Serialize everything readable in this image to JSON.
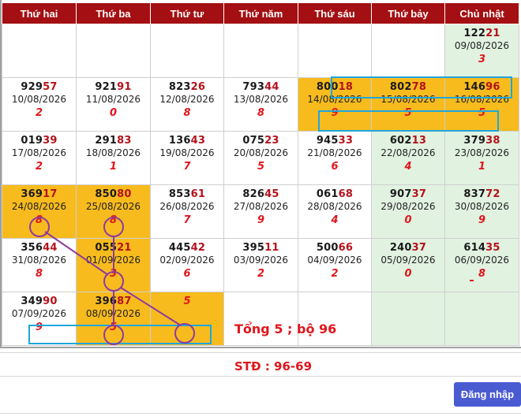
{
  "calendar": {
    "headers": [
      "Thứ hai",
      "Thứ ba",
      "Thứ tư",
      "Thứ năm",
      "Thứ sáu",
      "Thứ bảy",
      "Chủ nhật"
    ],
    "weeks": [
      [
        null,
        null,
        null,
        null,
        null,
        null,
        {
          "head": "122",
          "tail": "21",
          "date": "09/08/2026",
          "sum": "3",
          "style": "weekend"
        }
      ],
      [
        {
          "head": "929",
          "tail": "57",
          "date": "10/08/2026",
          "sum": "2",
          "style": "white"
        },
        {
          "head": "921",
          "tail": "91",
          "date": "11/08/2026",
          "sum": "0",
          "style": "white"
        },
        {
          "head": "823",
          "tail": "26",
          "date": "12/08/2026",
          "sum": "8",
          "style": "white"
        },
        {
          "head": "793",
          "tail": "44",
          "date": "13/08/2026",
          "sum": "8",
          "style": "white"
        },
        {
          "head": "800",
          "tail": "18",
          "date": "14/08/2026",
          "sum": "9",
          "style": "hl"
        },
        {
          "head": "802",
          "tail": "78",
          "date": "15/08/2026",
          "sum": "5",
          "style": "hl"
        },
        {
          "head": "146",
          "tail": "96",
          "date": "16/08/2026",
          "sum": "5",
          "style": "hl"
        }
      ],
      [
        {
          "head": "019",
          "tail": "39",
          "date": "17/08/2026",
          "sum": "2",
          "style": "white"
        },
        {
          "head": "291",
          "tail": "83",
          "date": "18/08/2026",
          "sum": "1",
          "style": "white"
        },
        {
          "head": "136",
          "tail": "43",
          "date": "19/08/2026",
          "sum": "7",
          "style": "white"
        },
        {
          "head": "075",
          "tail": "23",
          "date": "20/08/2026",
          "sum": "5",
          "style": "white"
        },
        {
          "head": "945",
          "tail": "33",
          "date": "21/08/2026",
          "sum": "6",
          "style": "white"
        },
        {
          "head": "602",
          "tail": "13",
          "date": "22/08/2026",
          "sum": "4",
          "style": "weekend"
        },
        {
          "head": "379",
          "tail": "38",
          "date": "23/08/2026",
          "sum": "1",
          "style": "weekend"
        }
      ],
      [
        {
          "head": "369",
          "tail": "17",
          "date": "24/08/2026",
          "sum": "8",
          "style": "hl"
        },
        {
          "head": "850",
          "tail": "80",
          "date": "25/08/2026",
          "sum": "8",
          "style": "hl"
        },
        {
          "head": "853",
          "tail": "61",
          "date": "26/08/2026",
          "sum": "7",
          "style": "white"
        },
        {
          "head": "826",
          "tail": "45",
          "date": "27/08/2026",
          "sum": "9",
          "style": "white"
        },
        {
          "head": "061",
          "tail": "68",
          "date": "28/08/2026",
          "sum": "4",
          "style": "white"
        },
        {
          "head": "907",
          "tail": "37",
          "date": "29/08/2026",
          "sum": "0",
          "style": "weekend"
        },
        {
          "head": "837",
          "tail": "72",
          "date": "30/08/2026",
          "sum": "9",
          "style": "weekend"
        }
      ],
      [
        {
          "head": "356",
          "tail": "44",
          "date": "31/08/2026",
          "sum": "8",
          "style": "white"
        },
        {
          "head": "055",
          "tail": "21",
          "date": "01/09/2026",
          "sum": "3",
          "style": "hl"
        },
        {
          "head": "445",
          "tail": "42",
          "date": "02/09/2026",
          "sum": "6",
          "style": "white"
        },
        {
          "head": "395",
          "tail": "11",
          "date": "03/09/2026",
          "sum": "2",
          "style": "white"
        },
        {
          "head": "500",
          "tail": "66",
          "date": "04/09/2026",
          "sum": "2",
          "style": "white"
        },
        {
          "head": "240",
          "tail": "37",
          "date": "05/09/2026",
          "sum": "0",
          "style": "weekend"
        },
        {
          "head": "614",
          "tail": "35",
          "date": "06/09/2026",
          "sum": "8",
          "style": "weekend"
        }
      ],
      [
        {
          "head": "349",
          "tail": "90",
          "date": "07/09/2026",
          "sum": "9",
          "style": "white"
        },
        {
          "head": "396",
          "tail": "87",
          "date": "08/09/2026",
          "sum": "5",
          "style": "hl"
        },
        {
          "head": "",
          "tail": "",
          "date": "",
          "sum": "5",
          "style": "hl"
        },
        null,
        null,
        {
          "empty": true,
          "style": "weekend"
        },
        {
          "empty": true,
          "style": "weekend"
        }
      ]
    ]
  },
  "annotations": {
    "total_note": "Tổng 5 ; bộ 96",
    "std_note": "STĐ : 96-69"
  },
  "login_label": "Đăng nhập",
  "colors": {
    "header_bg": "#a30f12",
    "highlight": "#f7bb1e",
    "weekend": "#e1f2e1",
    "sum_red": "#e0161c",
    "button": "#4a5bd2",
    "frame_blue": "#1fa6dc",
    "line_purple": "#8e3a9e"
  }
}
